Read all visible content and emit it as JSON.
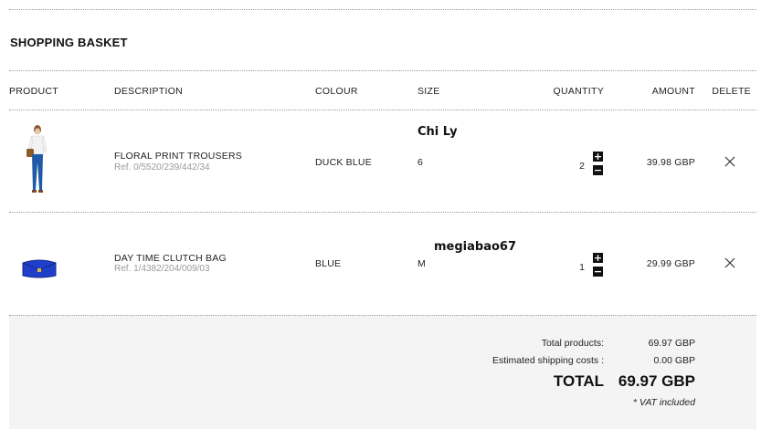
{
  "basket": {
    "title": "SHOPPING BASKET"
  },
  "headers": {
    "product": "PRODUCT",
    "description": "DESCRIPTION",
    "colour": "COLOUR",
    "size": "SIZE",
    "quantity": "QUANTITY",
    "amount": "AMOUNT",
    "delete": "DELETE"
  },
  "items": [
    {
      "name": "FLORAL PRINT TROUSERS",
      "ref": "Ref. 0/5520/239/442/34",
      "colour": "DUCK BLUE",
      "size": "6",
      "quantity": "2",
      "amount": "39.98 GBP",
      "overlay_label": "Chi Ly",
      "image_icon": "model-wearing-trousers"
    },
    {
      "name": "DAY TIME CLUTCH BAG",
      "ref": "Ref. 1/4382/204/009/03",
      "colour": "BLUE",
      "size": "M",
      "quantity": "1",
      "amount": "29.99 GBP",
      "overlay_label": "megiabao67",
      "image_icon": "blue-clutch-bag"
    }
  ],
  "controls": {
    "plus": "+",
    "minus": "−"
  },
  "summary": {
    "total_products_label": "Total products:",
    "total_products_value": "69.97 GBP",
    "shipping_label": "Estimated shipping costs :",
    "shipping_value": "0.00 GBP",
    "total_label": "TOTAL",
    "total_value": "69.97 GBP",
    "vat_note": "* VAT included"
  },
  "colors": {
    "bag_blue": "#1f3fc8",
    "jeans_blue": "#1f5aa6",
    "footer_bg": "#f4f4f4"
  }
}
